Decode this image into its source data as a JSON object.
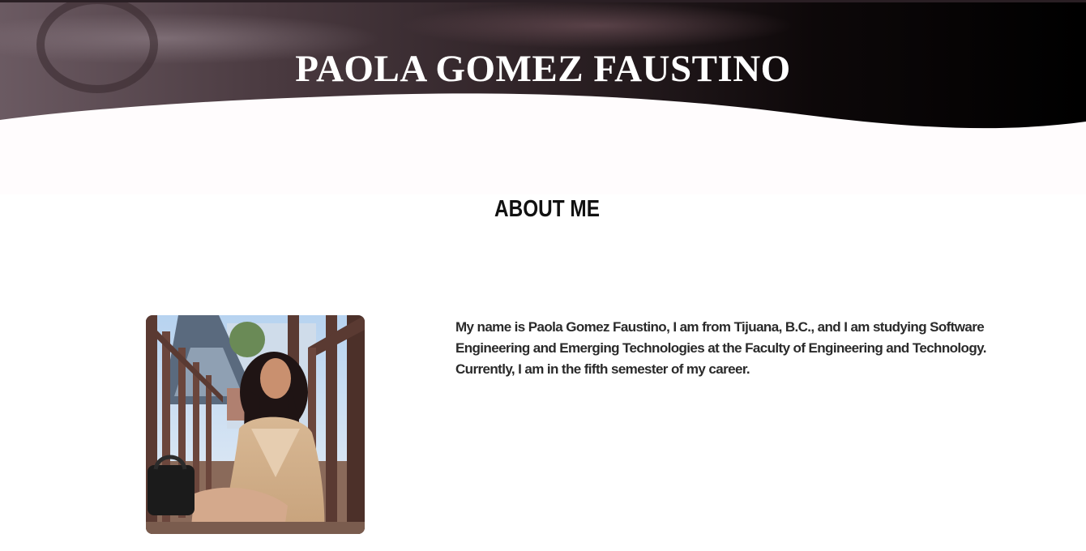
{
  "header": {
    "title": "PAOLA GOMEZ FAUSTINO"
  },
  "about": {
    "heading": "ABOUT ME",
    "bio": "My name is Paola Gomez Faustino, I am from Tijuana, B.C., and I am studying Software Engineering and Emerging Technologies at the Faculty of Engineering and Technology. Currently, I am in the fifth semester of my career."
  },
  "colors": {
    "hero_dark": "#000000",
    "hero_tint": "#3b2a30",
    "page_background": "#ffffff",
    "heading_text": "#111111",
    "body_text": "#2a2a2a"
  },
  "icons": {
    "profile_photo": "profile-photo"
  }
}
